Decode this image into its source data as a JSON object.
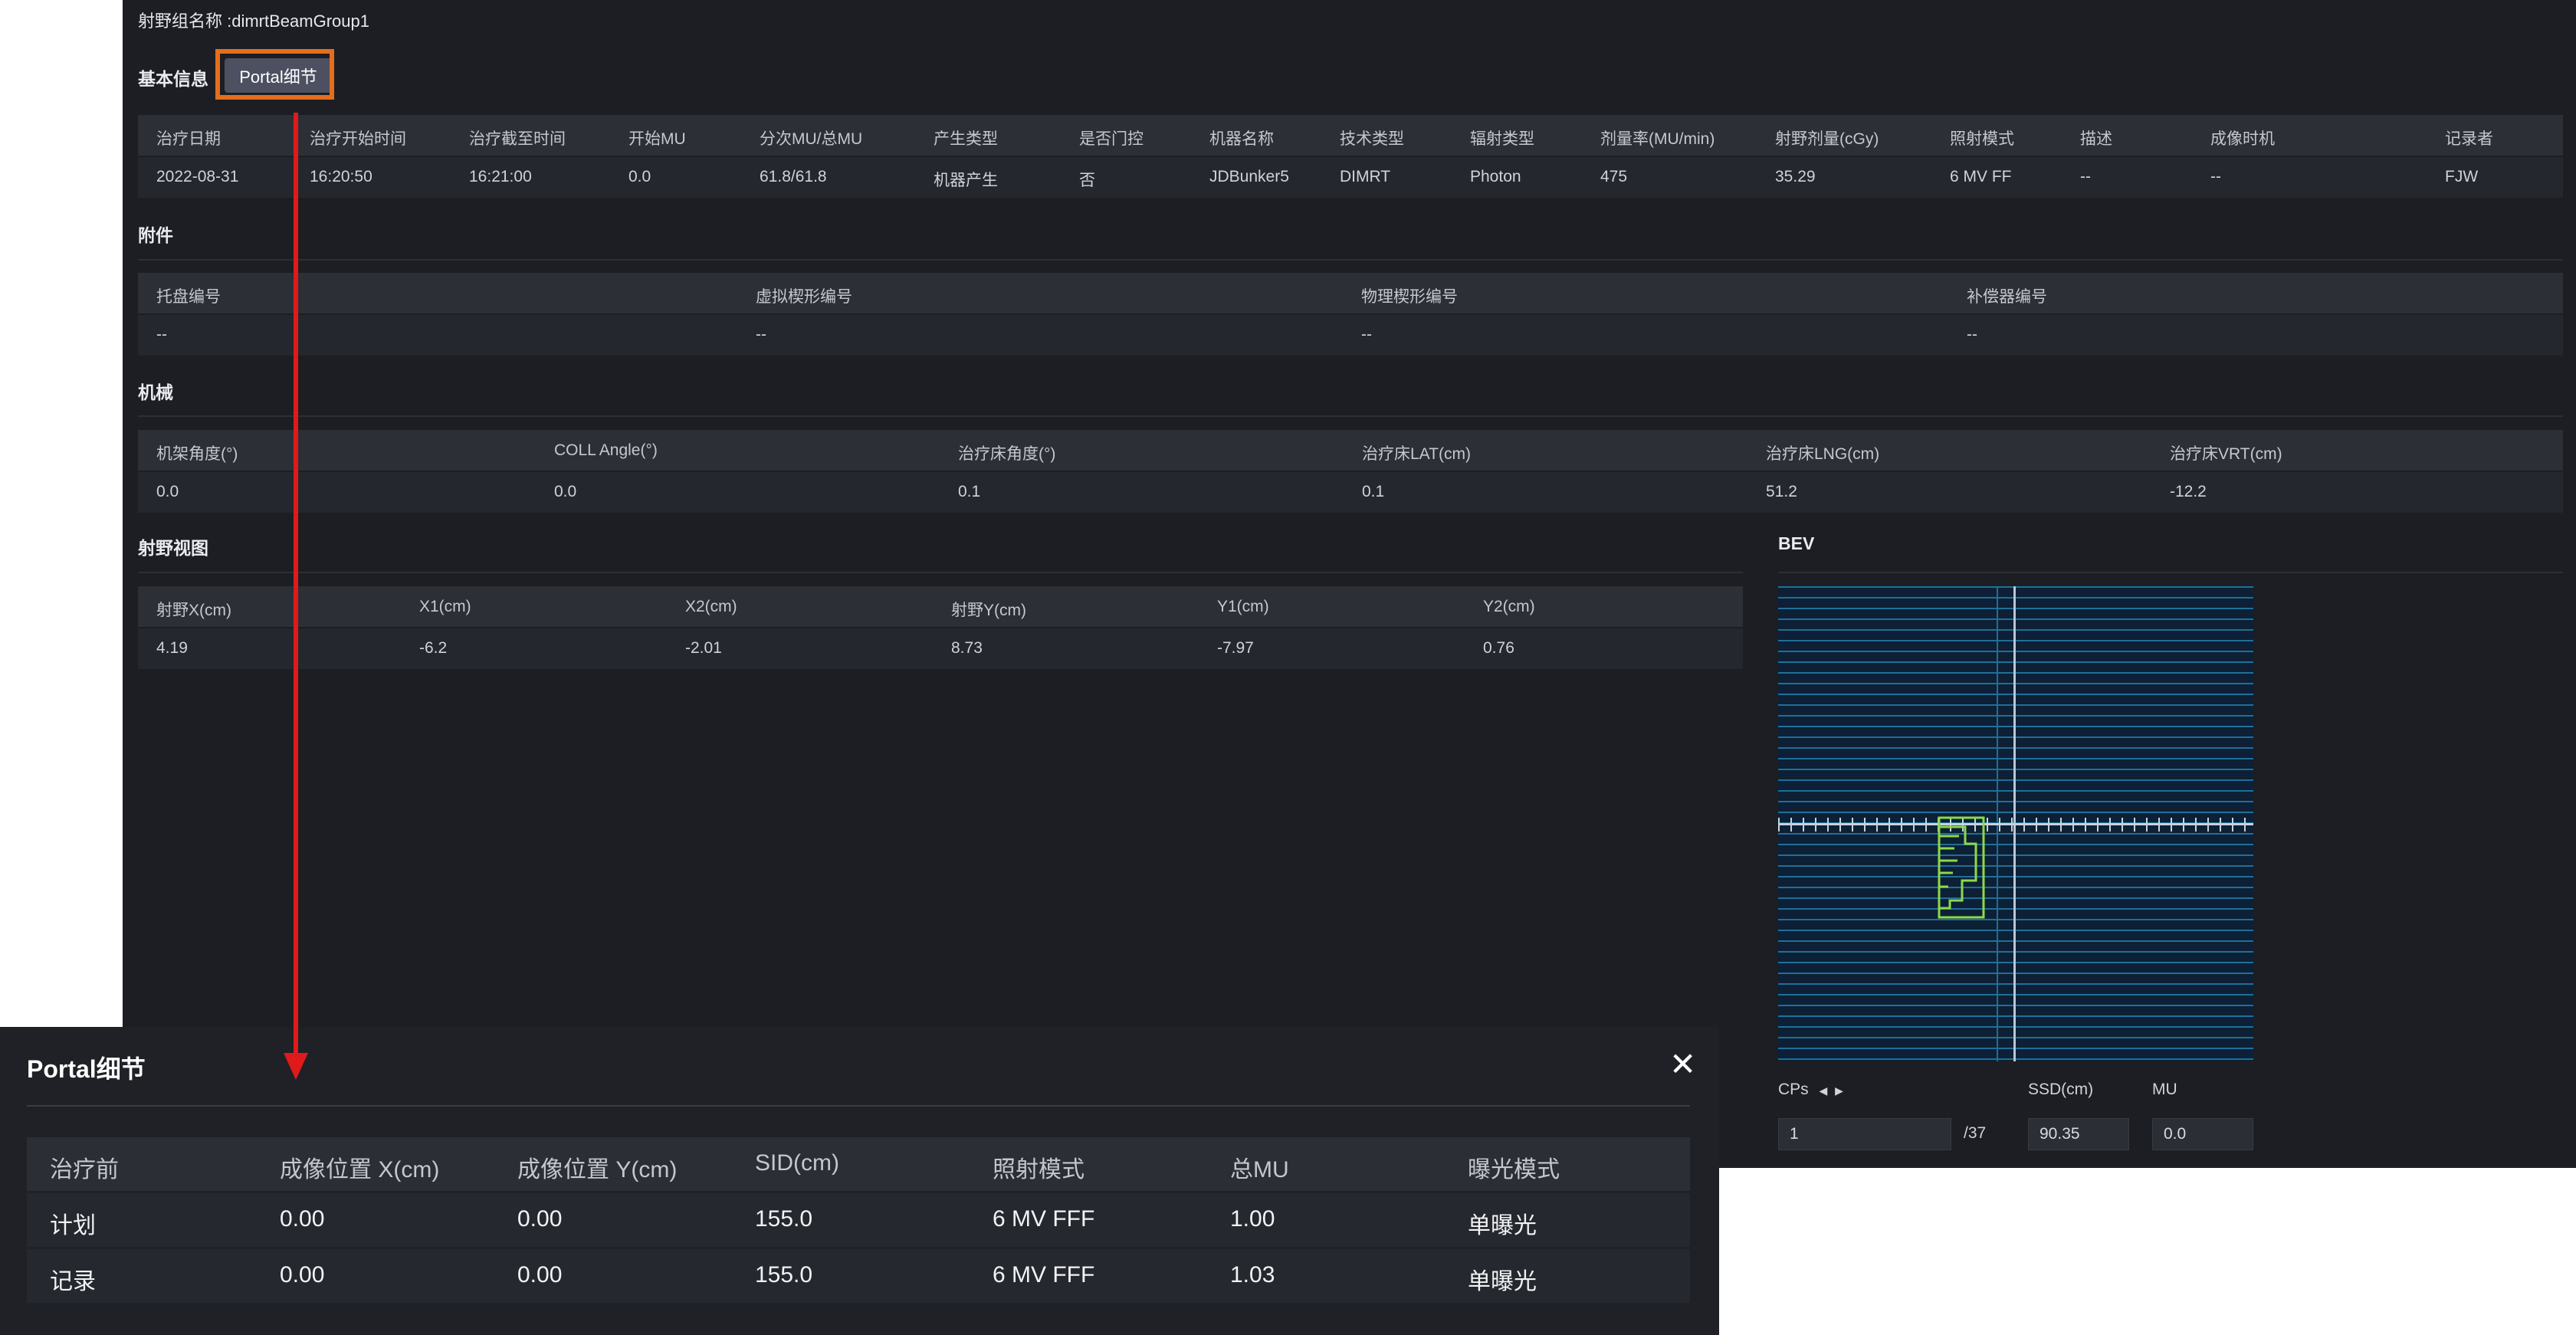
{
  "header": {
    "group_name": "射野组名称 :dimrtBeamGroup1"
  },
  "basic": {
    "title": "基本信息",
    "portal_button": "Portal细节",
    "headers": [
      "治疗日期",
      "治疗开始时间",
      "治疗截至时间",
      "开始MU",
      "分次MU/总MU",
      "产生类型",
      "是否门控",
      "机器名称",
      "技术类型",
      "辐射类型",
      "剂量率(MU/min)",
      "射野剂量(cGy)",
      "照射模式",
      "描述",
      "成像时机",
      "记录者"
    ],
    "values": [
      "2022-08-31",
      "16:20:50",
      "16:21:00",
      "0.0",
      "61.8/61.8",
      "机器产生",
      "否",
      "JDBunker5",
      "DIMRT",
      "Photon",
      "475",
      "35.29",
      "6 MV FF",
      "--",
      "--",
      "FJW"
    ]
  },
  "accessory": {
    "title": "附件",
    "headers": [
      "托盘编号",
      "虚拟楔形编号",
      "物理楔形编号",
      "补偿器编号"
    ],
    "values": [
      "--",
      "--",
      "--",
      "--"
    ]
  },
  "mechanical": {
    "title": "机械",
    "headers": [
      "机架角度(°)",
      "COLL Angle(°)",
      "治疗床角度(°)",
      "治疗床LAT(cm)",
      "治疗床LNG(cm)",
      "治疗床VRT(cm)"
    ],
    "values": [
      "0.0",
      "0.0",
      "0.1",
      "0.1",
      "51.2",
      "-12.2"
    ]
  },
  "fieldview": {
    "title": "射野视图",
    "headers": [
      "射野X(cm)",
      "X1(cm)",
      "X2(cm)",
      "射野Y(cm)",
      "Y1(cm)",
      "Y2(cm)"
    ],
    "values": [
      "4.19",
      "-6.2",
      "-2.01",
      "8.73",
      "-7.97",
      "0.76"
    ]
  },
  "bev": {
    "title": "BEV",
    "cps_label": "CPs",
    "ssd_label": "SSD(cm)",
    "mu_label": "MU",
    "cps_value": "1",
    "cps_total": "/37",
    "ssd_value": "90.35",
    "mu_value": "0.0",
    "colors": {
      "grid": "#1f6f99",
      "aperture": "#8bd94a",
      "background": "#0d2035"
    }
  },
  "popup": {
    "title": "Portal细节",
    "headers": [
      "治疗前",
      "成像位置 X(cm)",
      "成像位置 Y(cm)",
      "SID(cm)",
      "照射模式",
      "总MU",
      "曝光模式"
    ],
    "rows": [
      [
        "计划",
        "0.00",
        "0.00",
        "155.0",
        "6 MV FFF",
        "1.00",
        "单曝光"
      ],
      [
        "记录",
        "0.00",
        "0.00",
        "155.0",
        "6 MV FFF",
        "1.03",
        "单曝光"
      ]
    ]
  },
  "annotation_colors": {
    "highlight": "#e46e1c",
    "arrow": "#e01a1a"
  }
}
